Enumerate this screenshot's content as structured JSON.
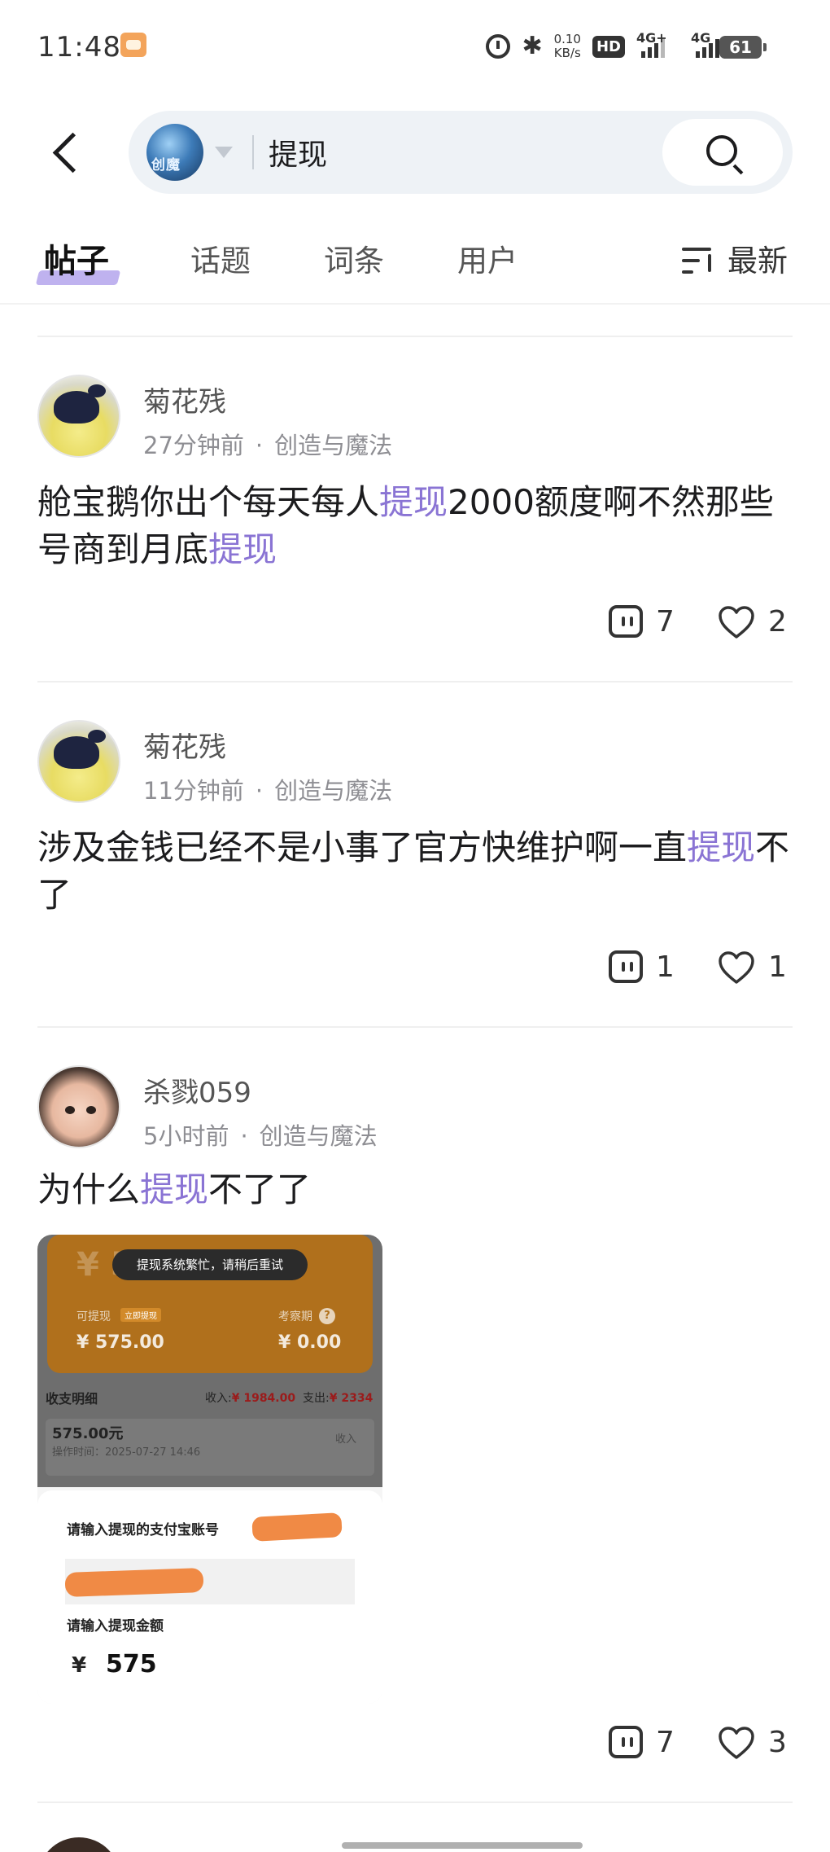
{
  "status_bar": {
    "time": "11:48",
    "net_speed_value": "0.10",
    "net_speed_unit": "KB/s",
    "hd_label": "HD",
    "sim1_label": "4G+",
    "sim2_label": "4G",
    "battery": "61"
  },
  "search": {
    "query": "提现",
    "logo_text": "创魔"
  },
  "tabs": [
    {
      "label": "帖子",
      "active": true
    },
    {
      "label": "话题",
      "active": false
    },
    {
      "label": "词条",
      "active": false
    },
    {
      "label": "用户",
      "active": false
    }
  ],
  "sort": {
    "label": "最新"
  },
  "posts": [
    {
      "username": "菊花残",
      "time": "27分钟前",
      "dot": "·",
      "category": "创造与魔法",
      "content_parts": [
        "舱宝鹅你出个每天每人",
        "提现",
        "2000额度啊不然那些号商到月底",
        "提现"
      ],
      "comments": "7",
      "likes": "2"
    },
    {
      "username": "菊花残",
      "time": "11分钟前",
      "dot": "·",
      "category": "创造与魔法",
      "content_parts": [
        "涉及金钱已经不是小事了官方快维护啊一直",
        "提现",
        "不了"
      ],
      "comments": "1",
      "likes": "1"
    },
    {
      "username": "杀戮059",
      "time": "5小时前",
      "dot": "·",
      "category": "创造与魔法",
      "content_parts": [
        "为什么",
        "提现",
        "不了了"
      ],
      "comments": "7",
      "likes": "3",
      "image": {
        "big_value": "¥ 575.00",
        "toast": "提现系统繁忙，请稍后重试",
        "withdrawable_label": "可提现",
        "withdraw_tag": "立即提现",
        "withdrawable_amount": "¥ 575.00",
        "review_label": "考察期",
        "review_amount": "¥ 0.00",
        "ledger_title": "收支明细",
        "income_label": "收入:",
        "income_value": "¥ 1984.00",
        "expense_label": "支出:",
        "expense_value": "¥ 2334",
        "row_amount": "575.00元",
        "row_time": "操作时间：2025-07-27 14:46",
        "row_type": "收入",
        "account_prompt": "请输入提现的支付宝账号",
        "amount_prompt": "请输入提现金额",
        "currency": "¥",
        "amount_value": "575"
      }
    }
  ]
}
